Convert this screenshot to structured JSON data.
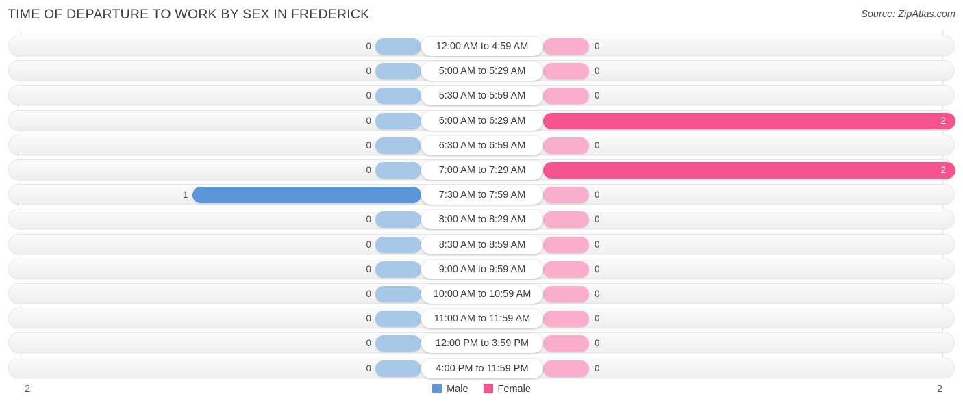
{
  "header": {
    "title": "TIME OF DEPARTURE TO WORK BY SEX IN FREDERICK",
    "source": "Source: ZipAtlas.com"
  },
  "legend": {
    "items": [
      {
        "label": "Male",
        "color": "#5b96d8"
      },
      {
        "label": "Female",
        "color": "#f4538f"
      }
    ]
  },
  "axis": {
    "left_tick": "2",
    "right_tick": "2"
  },
  "colors": {
    "male_strong": "#5b96d8",
    "male_light": "#a8c8e8",
    "female_strong": "#f4538f",
    "female_light": "#f9aecb"
  },
  "chart_data": {
    "type": "bar",
    "orientation": "horizontal-diverging",
    "title": "TIME OF DEPARTURE TO WORK BY SEX IN FREDERICK",
    "xlabel": "",
    "ylabel": "",
    "xlim": [
      2,
      2
    ],
    "axis_left_max": 2,
    "axis_right_max": 2,
    "grid": false,
    "legend_position": "bottom-center",
    "categories": [
      "12:00 AM to 4:59 AM",
      "5:00 AM to 5:29 AM",
      "5:30 AM to 5:59 AM",
      "6:00 AM to 6:29 AM",
      "6:30 AM to 6:59 AM",
      "7:00 AM to 7:29 AM",
      "7:30 AM to 7:59 AM",
      "8:00 AM to 8:29 AM",
      "8:30 AM to 8:59 AM",
      "9:00 AM to 9:59 AM",
      "10:00 AM to 10:59 AM",
      "11:00 AM to 11:59 AM",
      "12:00 PM to 3:59 PM",
      "4:00 PM to 11:59 PM"
    ],
    "series": [
      {
        "name": "Male",
        "side": "left",
        "values": [
          0,
          0,
          0,
          0,
          0,
          0,
          1,
          0,
          0,
          0,
          0,
          0,
          0,
          0
        ],
        "labels": [
          "0",
          "0",
          "0",
          "0",
          "0",
          "0",
          "1",
          "0",
          "0",
          "0",
          "0",
          "0",
          "0",
          "0"
        ]
      },
      {
        "name": "Female",
        "side": "right",
        "values": [
          0,
          0,
          0,
          2,
          0,
          2,
          0,
          0,
          0,
          0,
          0,
          0,
          0,
          0
        ],
        "labels": [
          "0",
          "0",
          "0",
          "2",
          "0",
          "2",
          "0",
          "0",
          "0",
          "0",
          "0",
          "0",
          "0",
          "0"
        ]
      }
    ]
  }
}
